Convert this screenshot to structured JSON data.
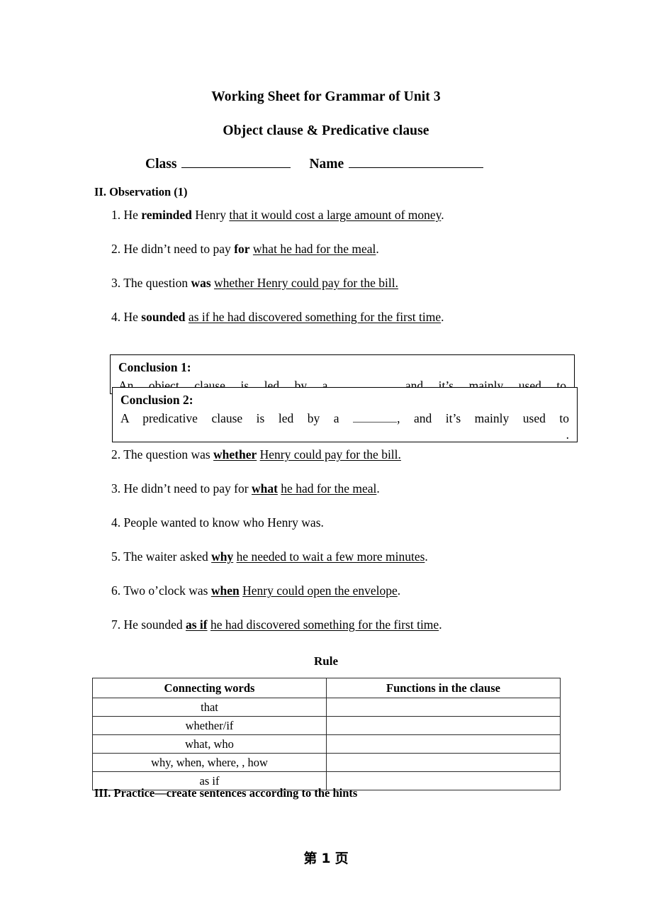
{
  "document": {
    "title_line_1": "Working Sheet for Grammar of Unit 3",
    "title_line_2": "Object clause & Predicative clause"
  },
  "identity_row": {
    "class_label": "Class",
    "name_label": "Name"
  },
  "sections": {
    "observation_heading": "II. Observation (1)",
    "practice_heading": "III. Practice—create sentences according to the hints"
  },
  "observation_items": [
    {
      "number": "1.",
      "lead": "He ",
      "bold": "reminded",
      "mid": " Henry ",
      "underlined": "that it would cost a large amount of money",
      "tail": "."
    },
    {
      "number": "2.",
      "lead": "He didn’t need to pay ",
      "bold": "for",
      "mid": " ",
      "underlined": "what he had for the meal",
      "tail": "."
    },
    {
      "number": "3.",
      "lead": "The question ",
      "bold": "was",
      "mid": " ",
      "underlined": "whether Henry could pay for the bill.",
      "tail": ""
    },
    {
      "number": "4.",
      "lead": "He ",
      "bold": "sounded",
      "mid": " ",
      "underlined": "as if he had discovered something for the first time",
      "tail": "."
    }
  ],
  "conclusions": [
    {
      "heading": "Conclusion 1:",
      "body_prefix": "An object clause is led by a ",
      "body_middle": ", and it’s mainly used to",
      "body_suffix": "."
    },
    {
      "heading": "Conclusion 2:",
      "body_prefix": "A predicative clause is led by a ",
      "body_middle": ", and it’s mainly used to",
      "body_suffix": "."
    }
  ],
  "observation_items_2": [
    {
      "number": "2.",
      "lead": "The question was ",
      "bold_underlined": "whether",
      "mid": " ",
      "underlined": "Henry could pay for the bill.",
      "tail": ""
    },
    {
      "number": "3.",
      "lead": "He didn’t need to pay for ",
      "bold_underlined": "what",
      "mid": " ",
      "underlined": "he had for the meal",
      "tail": "."
    },
    {
      "number": "4.",
      "lead": "People wanted to know who Henry was.",
      "bold_underlined": "",
      "mid": "",
      "underlined": "",
      "tail": ""
    },
    {
      "number": "5.",
      "lead": "The waiter asked ",
      "bold_underlined": "why",
      "mid": " ",
      "underlined": "he needed to wait a few more minutes",
      "tail": "."
    },
    {
      "number": "6.",
      "lead": "Two o’clock was ",
      "bold_underlined": "when",
      "mid": " ",
      "underlined": "Henry could open the envelope",
      "tail": "."
    },
    {
      "number": "7.",
      "lead": "He sounded ",
      "bold_underlined": "as if",
      "mid": " ",
      "underlined": "he had discovered something for the first time",
      "tail": "."
    }
  ],
  "rule": {
    "caption": "Rule",
    "headers": [
      "Connecting words",
      "Functions in the clause"
    ],
    "rows": [
      {
        "connecting_words": "that",
        "function": ""
      },
      {
        "connecting_words": "whether/if",
        "function": ""
      },
      {
        "connecting_words": "what, who",
        "function": ""
      },
      {
        "connecting_words": "why, when, where, , how",
        "function": ""
      },
      {
        "connecting_words": "as if",
        "function": ""
      }
    ]
  },
  "footer": {
    "prefix": "第",
    "page_number": "1",
    "suffix": "页"
  }
}
